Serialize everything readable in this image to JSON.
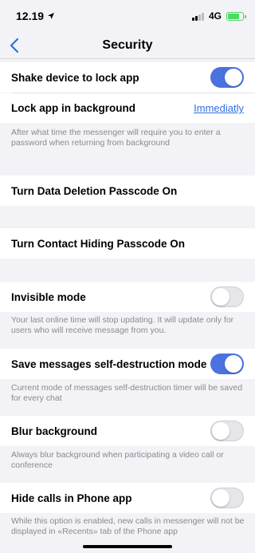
{
  "status_bar": {
    "time": "12.19",
    "network": "4G"
  },
  "nav": {
    "title": "Security"
  },
  "items": {
    "shake": {
      "label": "Shake device to lock app",
      "enabled": true
    },
    "lock_bg": {
      "label": "Lock app in background",
      "value": "Immediatly",
      "note": "After what time the messenger will require you to enter a password when returning from background"
    },
    "data_deletion": {
      "label": "Turn Data Deletion Passcode On"
    },
    "contact_hiding": {
      "label": "Turn Contact Hiding Passcode On"
    },
    "invisible": {
      "label": "Invisible mode",
      "enabled": false,
      "note": "Your last online time will stop updating. It will update only for users who will receive message from you."
    },
    "self_destruct": {
      "label": "Save messages self-destruction mode",
      "enabled": true,
      "note": "Current mode of messages self-destruction timer will be saved for every chat"
    },
    "blur": {
      "label": "Blur background",
      "enabled": false,
      "note": "Always blur background when participating a video call or conference"
    },
    "hide_calls": {
      "label": "Hide calls in Phone app",
      "enabled": false,
      "note": "While this option is enabled, new calls in messenger will not be displayed in «Recents» tab of the Phone app"
    }
  },
  "colors": {
    "accent": "#4a72e0",
    "link": "#2f6fe4",
    "battery": "#4cd964"
  }
}
